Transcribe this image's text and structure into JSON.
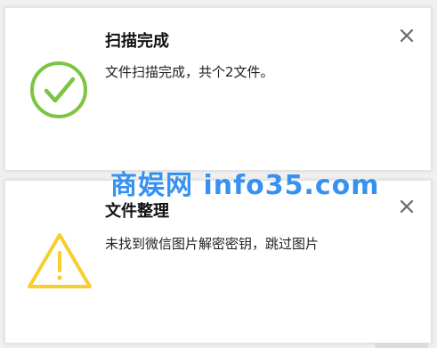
{
  "notifications": [
    {
      "title": "扫描完成",
      "message": "文件扫描完成，共个2文件。",
      "icon": "check-circle-icon",
      "color": "#7cc444"
    },
    {
      "title": "文件整理",
      "message": "未找到微信图片解密密钥，跳过图片",
      "icon": "warning-triangle-icon",
      "color": "#f5cf2e"
    }
  ],
  "watermark": "商娱网 info35.com",
  "colors": {
    "close": "#6a6a6a",
    "watermark": "#2d8cf0"
  }
}
